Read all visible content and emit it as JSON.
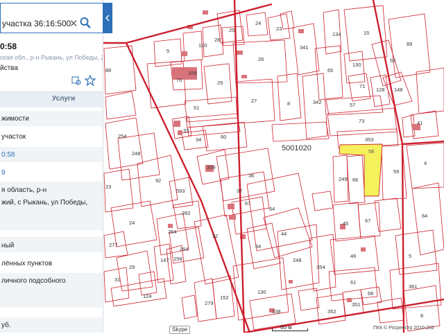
{
  "search": {
    "query": "участка 36:16:500"
  },
  "object": {
    "number": "0:58",
    "address": "ская обл., р-н Рыкань, ул Победы, 20б",
    "type": "йства"
  },
  "services": {
    "header": "Услуги"
  },
  "info_rows": [
    "жимости",
    "участок",
    "0:58",
    "9",
    "я область, р-н",
    "жий, с Рыкань, ул Победы,",
    "ный",
    "лённых пунктов",
    "личного подсобного",
    "уб."
  ],
  "map": {
    "block_label": "5001020",
    "selected_parcel": "58",
    "parcel_labels": [
      "25",
      "24",
      "23",
      "5",
      "120",
      "28",
      "341",
      "134",
      "15",
      "89",
      "26",
      "65",
      "130",
      "71",
      "55",
      "70",
      "109",
      "29",
      "88",
      "128",
      "148",
      "27",
      "8",
      "342",
      "57",
      "51",
      "60",
      "73",
      "41",
      "33",
      "34",
      "254",
      "248",
      "353",
      "339",
      "58",
      "4",
      "59",
      "36",
      "92",
      "23",
      "249",
      "66",
      "593",
      "37",
      "67",
      "64",
      "24",
      "282",
      "264",
      "45",
      "67",
      "32",
      "44",
      "64",
      "277",
      "264",
      "46",
      "5",
      "29",
      "158",
      "147",
      "248",
      "354",
      "31",
      "61",
      "361",
      "130",
      "124",
      "279",
      "152",
      "138",
      "352",
      "351",
      "68",
      "64",
      "8"
    ],
    "colors": {
      "boundary": "#cc1f2d",
      "selected_fill": "#f5f15c",
      "building": "#d9737b"
    }
  },
  "footer": {
    "skype": "Skype",
    "scale": "60 м",
    "copyright": "ПКК © Росреестр 2010-202"
  }
}
